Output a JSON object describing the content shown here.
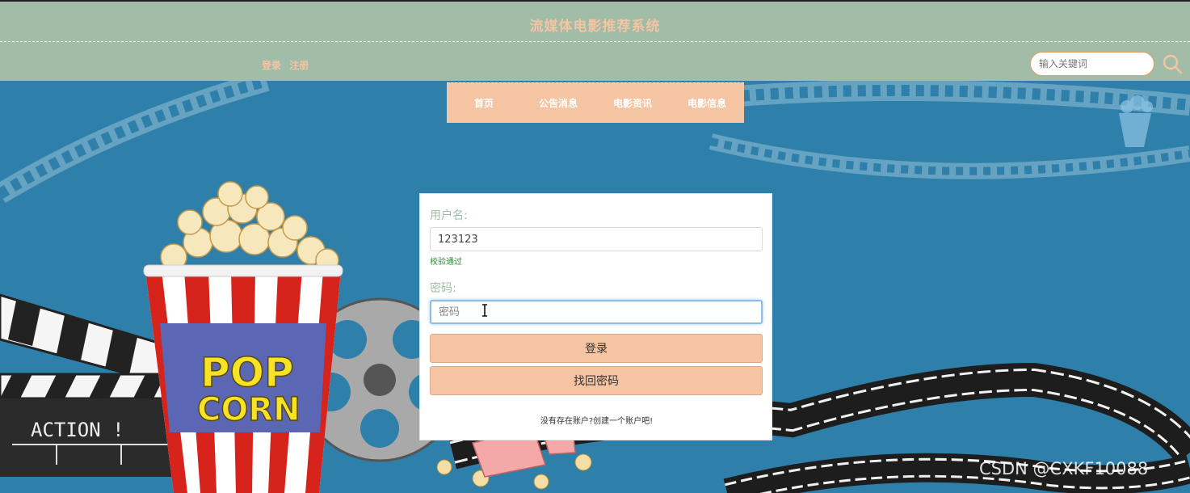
{
  "header": {
    "site_title": "流媒体电影推荐系统",
    "login_link": "登录",
    "register_link": "注册",
    "search_placeholder": "输入关键词"
  },
  "nav": {
    "items": [
      {
        "label": "首页"
      },
      {
        "label": "公告消息"
      },
      {
        "label": "电影资讯"
      },
      {
        "label": "电影信息"
      }
    ]
  },
  "login": {
    "username_label": "用户名:",
    "username_value": "123123",
    "validation_text": "校验通过",
    "password_label": "密码:",
    "password_placeholder": "密码",
    "login_button": "登录",
    "recover_button": "找回密码",
    "register_prompt": "没有存在账户?创建一个账户吧!"
  },
  "background": {
    "clapper_text": "ACTION !",
    "popcorn_text_top": "POP",
    "popcorn_text_bottom": "CORN"
  },
  "watermark": "CSDN @CXKF10088",
  "colors": {
    "header_bg": "#a1bca7",
    "accent": "#f4c4a3",
    "page_bg": "#2e7fa9",
    "valid_green": "#2e8b3a"
  }
}
